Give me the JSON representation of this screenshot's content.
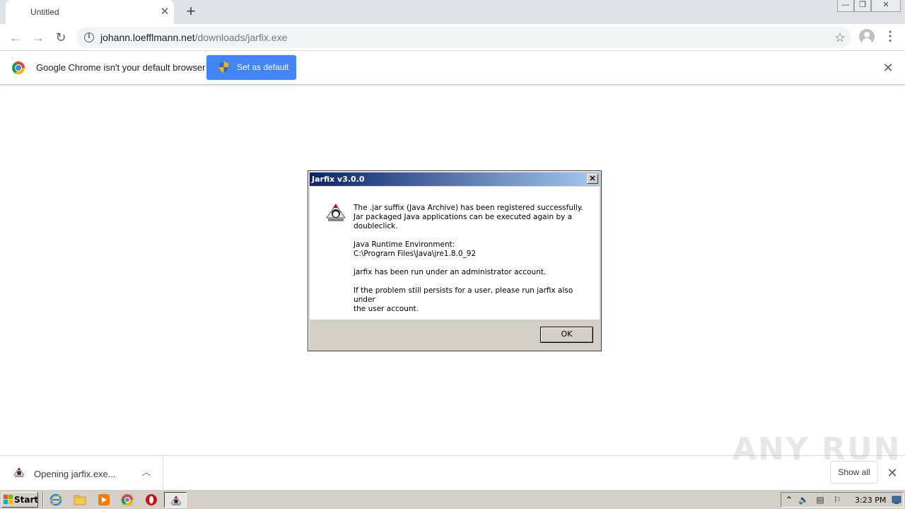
{
  "browser": {
    "tab_title": "Untitled",
    "tab_close": "✕",
    "new_tab": "+",
    "url_host": "johann.loefflmann.net",
    "url_path": "/downloads/jarfix.exe",
    "window_controls": [
      "—",
      "❐",
      "✕"
    ]
  },
  "infobar": {
    "message": "Google Chrome isn't your default browser",
    "button_label": "Set as default",
    "close": "✕"
  },
  "dialog": {
    "title": "Jarfix v3.0.0",
    "close": "✕",
    "paragraphs": [
      "The .jar suffix (Java Archive) has been registered successfully.\nJar packaged Java applications can be executed again by a\ndoubleclick.",
      "Java Runtime Environment:\nC:\\Program Files\\Java\\jre1.8.0_92",
      "jarfix has been run under an administrator account.",
      "If the problem still persists for a user, please run jarfix also under\nthe user account."
    ],
    "ok_label": "OK"
  },
  "downloads": {
    "item_label": "Opening jarfix.exe...",
    "show_all": "Show all",
    "close": "✕",
    "watermark": "ANY RUN"
  },
  "taskbar": {
    "start_label": "Start",
    "clock": "3:23 PM"
  },
  "colors": {
    "accent_blue": "#4285f4",
    "dialog_title_start": "#0a246a",
    "dialog_title_end": "#a6caf0",
    "win_face": "#d4d0c8"
  }
}
